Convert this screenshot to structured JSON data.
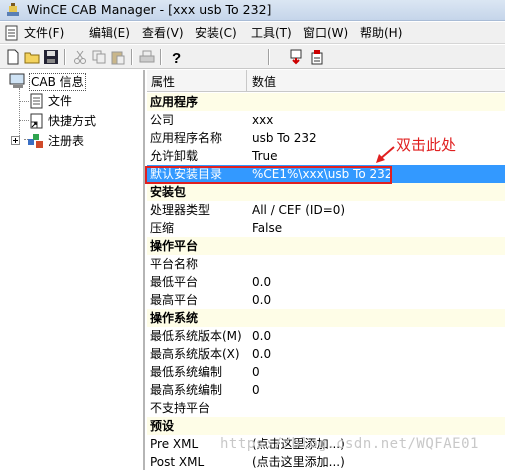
{
  "window": {
    "title": "WinCE CAB Manager - [xxx usb To 232]"
  },
  "menu": {
    "items": [
      "文件(F)",
      "编辑(E)",
      "查看(V)",
      "安装(C)",
      "工具(T)",
      "窗口(W)",
      "帮助(H)"
    ]
  },
  "toolbar": {
    "icons": [
      "new-icon",
      "open-icon",
      "save-icon",
      "cut-icon",
      "copy-icon",
      "paste-icon",
      "print-icon",
      "help-icon",
      "build-icon",
      "export-icon"
    ]
  },
  "tree": {
    "root": "CAB 信息",
    "items": [
      "文件",
      "快捷方式",
      "注册表"
    ]
  },
  "grid": {
    "col_property": "属性",
    "col_value": "数值",
    "rows": [
      {
        "type": "cat",
        "name": "应用程序"
      },
      {
        "type": "prop",
        "name": "公司",
        "value": "xxx"
      },
      {
        "type": "prop",
        "name": "应用程序名称",
        "value": "usb To 232"
      },
      {
        "type": "prop",
        "name": "允许卸载",
        "value": "True"
      },
      {
        "type": "prop",
        "name": "默认安装目录",
        "value": "%CE1%\\xxx\\usb To 232",
        "highlight": true
      },
      {
        "type": "cat",
        "name": "安装包"
      },
      {
        "type": "prop",
        "name": "处理器类型",
        "value": "All / CEF (ID=0)"
      },
      {
        "type": "prop",
        "name": "压缩",
        "value": "False"
      },
      {
        "type": "cat",
        "name": "操作平台"
      },
      {
        "type": "prop",
        "name": "平台名称",
        "value": ""
      },
      {
        "type": "prop",
        "name": "最低平台",
        "value": "0.0"
      },
      {
        "type": "prop",
        "name": "最高平台",
        "value": "0.0"
      },
      {
        "type": "cat",
        "name": "操作系统"
      },
      {
        "type": "prop",
        "name": "最低系统版本(M)",
        "value": "0.0"
      },
      {
        "type": "prop",
        "name": "最高系统版本(X)",
        "value": "0.0"
      },
      {
        "type": "prop",
        "name": "最低系统编制",
        "value": "0"
      },
      {
        "type": "prop",
        "name": "最高系统编制",
        "value": "0"
      },
      {
        "type": "prop",
        "name": "不支持平台",
        "value": ""
      },
      {
        "type": "cat",
        "name": "预设"
      },
      {
        "type": "prop",
        "name": "Pre XML",
        "value": "(点击这里添加...)"
      },
      {
        "type": "prop",
        "name": "Post XML",
        "value": "(点击这里添加...)"
      }
    ]
  },
  "annotation": {
    "text": "双击此处",
    "color": "#e02020"
  },
  "watermark": "https://blog.csdn.net/WQFAE01"
}
